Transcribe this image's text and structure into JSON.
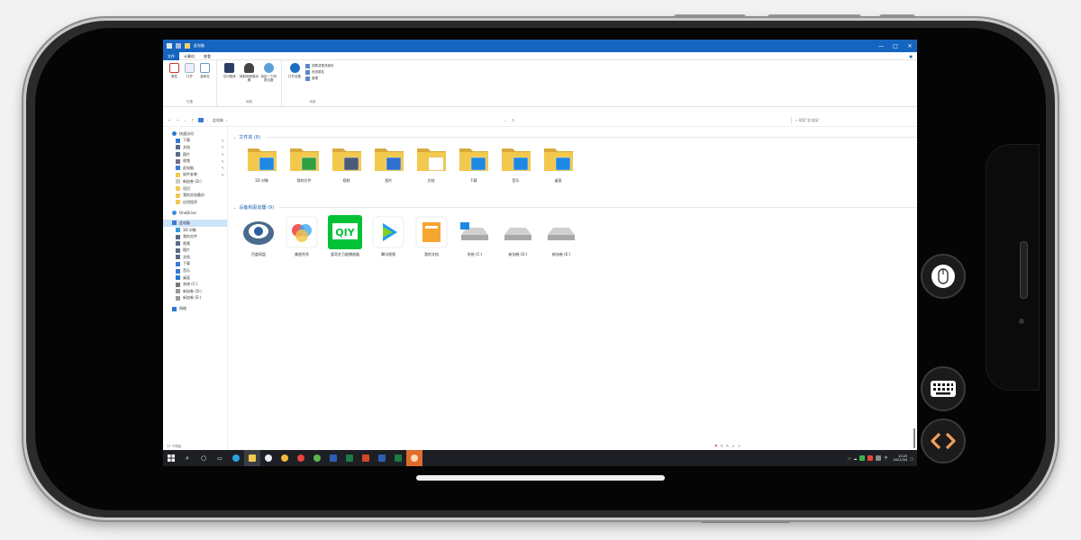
{
  "window": {
    "title": "此电脑",
    "controls": [
      "—",
      "□",
      "✕"
    ]
  },
  "ribbon": {
    "tabs": [
      "文件",
      "计算机",
      "查看"
    ],
    "group1": {
      "buttons": [
        "属性",
        "打开",
        "重命名"
      ],
      "label": "位置"
    },
    "group2": {
      "buttons": [
        "访问媒体",
        "映射网络驱动器",
        "添加一个网络位置"
      ],
      "label": "网络"
    },
    "group3": {
      "button": "打开设置",
      "small": [
        "卸载或更改程序",
        "系统属性",
        "管理"
      ],
      "label": "系统"
    }
  },
  "address": {
    "path": "此电脑",
    "search_placeholder": "搜索\"此电脑\""
  },
  "nav": {
    "quick_access": "快速访问",
    "quick_items": [
      "下载",
      "文档",
      "图片",
      "视频",
      "此电脑",
      "软件安装",
      "新加卷 (D:)",
      "项目",
      "我的文档备份",
      "应用程序"
    ],
    "onedrive": "OneDrive",
    "this_pc": "此电脑",
    "pc_items": [
      "3D 对象",
      "我的文件",
      "视频",
      "图片",
      "文档",
      "下载",
      "音乐",
      "桌面",
      "系统 (C:)",
      "新加卷 (D:)",
      "新加卷 (E:)"
    ],
    "network": "网络"
  },
  "content": {
    "folders_header": "文件夹 (8)",
    "folders": [
      "3D 对象",
      "我的文件",
      "视频",
      "图片",
      "文档",
      "下载",
      "音乐",
      "桌面"
    ],
    "devices_header": "设备和驱动器 (9)",
    "devices": [
      "百度网盘",
      "美图秀秀",
      "爱奇艺万能播放器",
      "腾讯视频",
      "我的文档",
      "系统 (C:)",
      "新加卷 (D:)",
      "新加卷 (E:)"
    ],
    "status_count": "17 个项目"
  },
  "taskbar": {
    "time": "10:25",
    "date": "2021/3/4",
    "lang": "中"
  },
  "colors": {
    "accent": "#1565c0",
    "folder": "#f2c94c",
    "folder_dark": "#d9a93a",
    "taskbar": "#1d1f24"
  }
}
